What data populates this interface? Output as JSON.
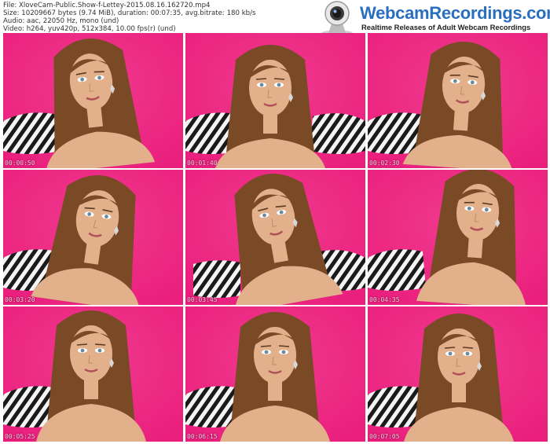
{
  "file_info": {
    "line1": "File: XloveCam-Public.Show-f-Lettey-2015.08.16.162720.mp4",
    "line2": "Size: 10209667 bytes (9.74 MiB), duration: 00:07:35, avg.bitrate: 180 kb/s",
    "line3": "Audio: aac, 22050 Hz, mono (und)",
    "line4": "Video: h264, yuv420p, 512x384, 10.00 fps(r) (und)"
  },
  "logo": {
    "title": "WebcamRecordings.com",
    "tagline": "Realtime Releases of Adult Webcam Recordings",
    "icon": "webcam-icon"
  },
  "thumbnails": [
    {
      "timestamp": "00:00:50"
    },
    {
      "timestamp": "00:01:40"
    },
    {
      "timestamp": "00:02:30"
    },
    {
      "timestamp": "00:03:20"
    },
    {
      "timestamp": "00:03:45"
    },
    {
      "timestamp": "00:04:35"
    },
    {
      "timestamp": "00:05:25"
    },
    {
      "timestamp": "00:06:15"
    },
    {
      "timestamp": "00:07:05"
    }
  ],
  "colors": {
    "background_pink": "#ea1f7d",
    "hair": "#7a4a26",
    "skin": "#e3b08c",
    "logo_blue": "#2a6fbf"
  }
}
